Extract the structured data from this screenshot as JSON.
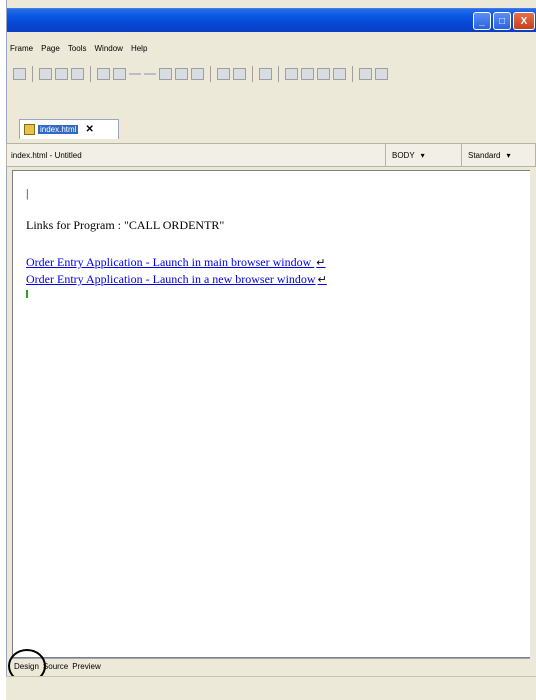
{
  "menu": [
    "Frame",
    "Page",
    "Tools",
    "Window",
    "Help"
  ],
  "tab": {
    "label": "index.html",
    "close": "✕"
  },
  "infobar": {
    "file_title": "index.html - Untitled",
    "tag_select": "BODY",
    "style_select": "Standard",
    "dropdown_glyph": "▾"
  },
  "editor": {
    "cursor": "|",
    "heading": "Links for Program : \"CALL ORDENTR\"",
    "links": [
      {
        "text": "Order Entry Application - Launch in main browser window "
      },
      {
        "text": "Order Entry Application - Launch in a new browser window"
      }
    ],
    "return_glyph": "↵"
  },
  "bottom_tabs": [
    "Design",
    "Source",
    "Preview"
  ],
  "titlebar": {
    "minimize": "_",
    "maximize": "□",
    "close": "X"
  },
  "colors": {
    "titlebar": "#0a58e3",
    "link": "#0000ee",
    "selected_tab": "#316ac5"
  }
}
